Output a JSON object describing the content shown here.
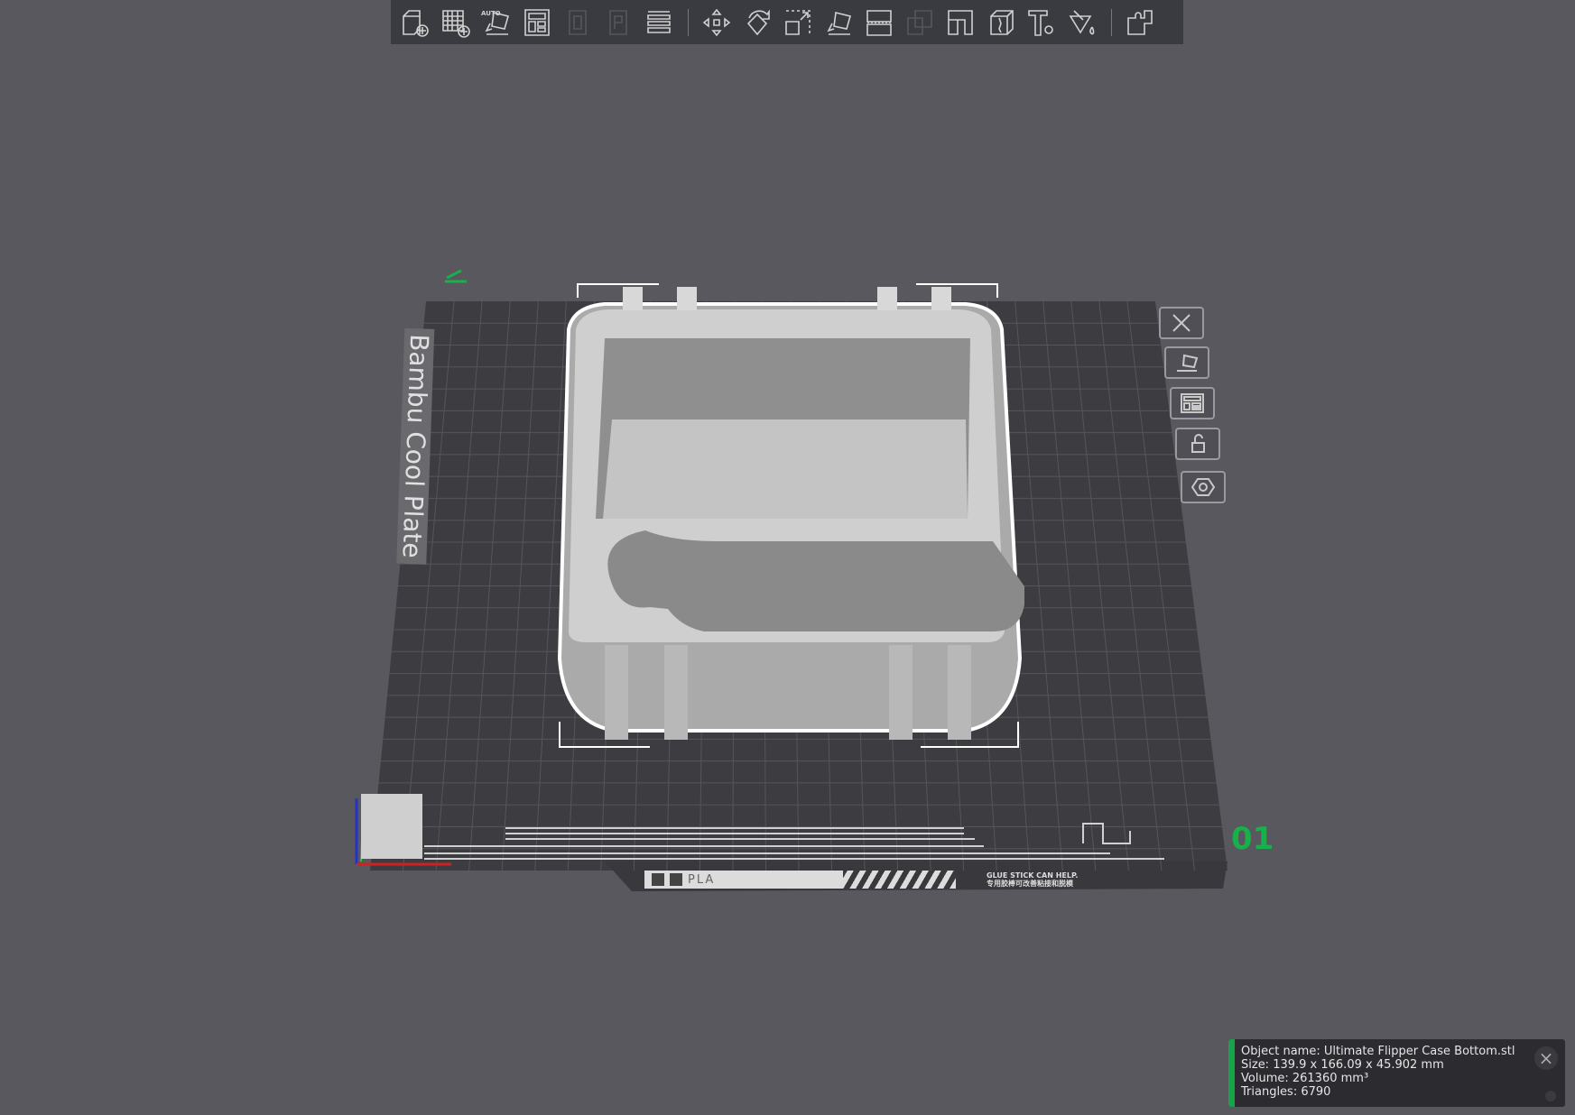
{
  "toolbar": {
    "items": [
      {
        "name": "add-object",
        "enabled": true
      },
      {
        "name": "add-plate",
        "enabled": true
      },
      {
        "name": "auto-orient",
        "enabled": true,
        "label": "AUTO"
      },
      {
        "name": "arrange",
        "enabled": true
      },
      {
        "name": "object-list",
        "enabled": false
      },
      {
        "name": "plate-list",
        "enabled": false
      },
      {
        "name": "layers",
        "enabled": true
      },
      {
        "name": "move",
        "enabled": true
      },
      {
        "name": "rotate",
        "enabled": true
      },
      {
        "name": "scale",
        "enabled": true
      },
      {
        "name": "lay-on-face",
        "enabled": true
      },
      {
        "name": "cut",
        "enabled": true
      },
      {
        "name": "mesh-boolean",
        "enabled": false
      },
      {
        "name": "support-painting",
        "enabled": true
      },
      {
        "name": "seam-painting",
        "enabled": true
      },
      {
        "name": "text",
        "enabled": true
      },
      {
        "name": "color-painting",
        "enabled": true
      },
      {
        "name": "assembly",
        "enabled": true
      }
    ]
  },
  "plate": {
    "name": "Bambu Cool Plate",
    "number": "01",
    "filament": "PLA",
    "hint_en": "GLUE STICK CAN HELP.",
    "hint_cn": "专用胶棒可改善粘接和脱模"
  },
  "plate_tools": [
    "close-plate",
    "auto-orient-plate",
    "arrange-plate",
    "lock-plate",
    "plate-settings"
  ],
  "object_info": {
    "name": "Object name: Ultimate Flipper Case Bottom.stl",
    "size": "Size: 139.9 x 166.09 x 45.902 mm",
    "volume": "Volume: 261360 mm³",
    "triangles": "Triangles: 6790"
  },
  "colors": {
    "accent": "#16a34a",
    "background": "#58585e",
    "plate": "#3c3c41"
  }
}
